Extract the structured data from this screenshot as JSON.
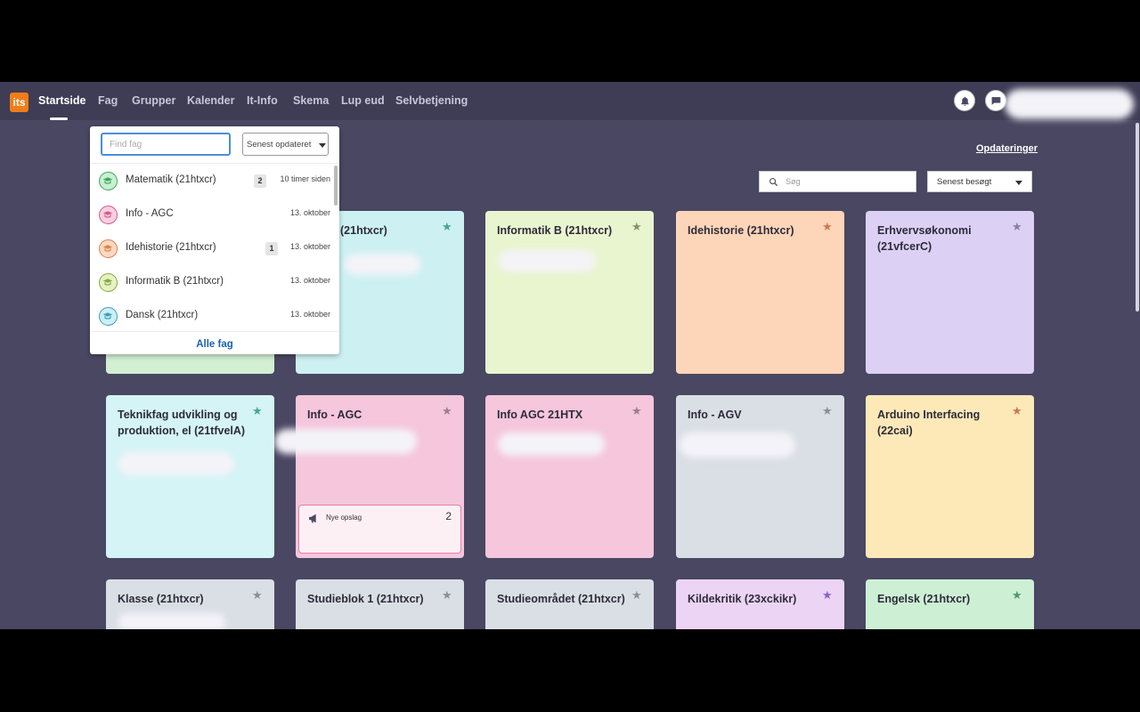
{
  "nav": {
    "logo": "its",
    "items": [
      {
        "label": "Startside"
      },
      {
        "label": "Fag"
      },
      {
        "label": "Grupper"
      },
      {
        "label": "Kalender"
      },
      {
        "label": "It-Info"
      },
      {
        "label": "Skema"
      },
      {
        "label": "Lup eud"
      },
      {
        "label": "Selvbetjening"
      }
    ],
    "active": "Startside"
  },
  "toolbar": {
    "updates_link": "Opdateringer",
    "search_placeholder": "Søg",
    "sort_label": "Senest besøgt"
  },
  "cards": [
    {
      "title": "(21htxcr)",
      "star_color": "#4aa39b",
      "bg": "#cdf1f2"
    },
    {
      "title": "Informatik B (21htxcr)",
      "star_color": "#8a9070",
      "bg": "#e9f5cf"
    },
    {
      "title": "Idehistorie (21htxcr)",
      "star_color": "#c9785a",
      "bg": "#fdd5b8"
    },
    {
      "title": "Erhvervsøkonomi (21vfcerC)",
      "star_color": "#8a7fa0",
      "bg": "#dcd1f5"
    },
    {
      "title": "Teknikfag udvikling og produktion, el (21tfvelA)",
      "star_color": "#4aa39b",
      "bg": "#d4f4f6"
    },
    {
      "title": "Info - AGC",
      "star_color": "#9a7f8c",
      "bg": "#f5c6dc"
    },
    {
      "title": "Info AGC 21HTX",
      "star_color": "#9a7f8c",
      "bg": "#f5c6dc"
    },
    {
      "title": "Info - AGV",
      "star_color": "#8a8f98",
      "bg": "#dadfe5"
    },
    {
      "title": "Arduino Interfacing (22cai)",
      "star_color": "#c9785a",
      "bg": "#fde9b8"
    },
    {
      "title": "Klasse (21htxcr)",
      "star_color": "#8a8f98",
      "bg": "#dadfe5"
    },
    {
      "title": "Studieblok 1 (21htxcr)",
      "star_color": "#8a8f98",
      "bg": "#dadfe5"
    },
    {
      "title": "Studieområdet (21htxcr)",
      "star_color": "#8a8f98",
      "bg": "#dadfe5"
    },
    {
      "title": "Kildekritik (23xckikr)",
      "star_color": "#8a5fbf",
      "bg": "#ecd4f5"
    },
    {
      "title": "Engelsk (21htxcr)",
      "star_color": "#4a9a6a",
      "bg": "#cdf0d5"
    },
    {
      "title": "",
      "star_color": "#4a9a6a",
      "bg": "#d2efd2"
    }
  ],
  "news": {
    "label": "Nye opslag",
    "count": "2"
  },
  "dropdown": {
    "search_placeholder": "Find fag",
    "sort_label": "Senest opdateret",
    "items": [
      {
        "name": "Matematik (21htxcr)",
        "badge": "2",
        "date": "10 timer siden",
        "color": "#3aa85a",
        "fill": "#c9efd3"
      },
      {
        "name": "Info - AGC",
        "badge": "",
        "date": "13. oktober",
        "color": "#d65a8e",
        "fill": "#f7d0e0"
      },
      {
        "name": "Idehistorie (21htxcr)",
        "badge": "1",
        "date": "13. oktober",
        "color": "#e0804a",
        "fill": "#fcd9c2"
      },
      {
        "name": "Informatik B (21htxcr)",
        "badge": "",
        "date": "13. oktober",
        "color": "#8aa83a",
        "fill": "#e6f2c6"
      },
      {
        "name": "Dansk (21htxcr)",
        "badge": "",
        "date": "13. oktober",
        "color": "#3aa0c0",
        "fill": "#cdeef4"
      }
    ],
    "all_link": "Alle fag"
  },
  "icons": {
    "logo": "its-logo-icon",
    "notification": "bell-icon",
    "messages": "chat-icon",
    "search": "search-icon",
    "favorite": "star-icon",
    "announcement": "megaphone-icon",
    "course": "graduation-cap-icon"
  }
}
